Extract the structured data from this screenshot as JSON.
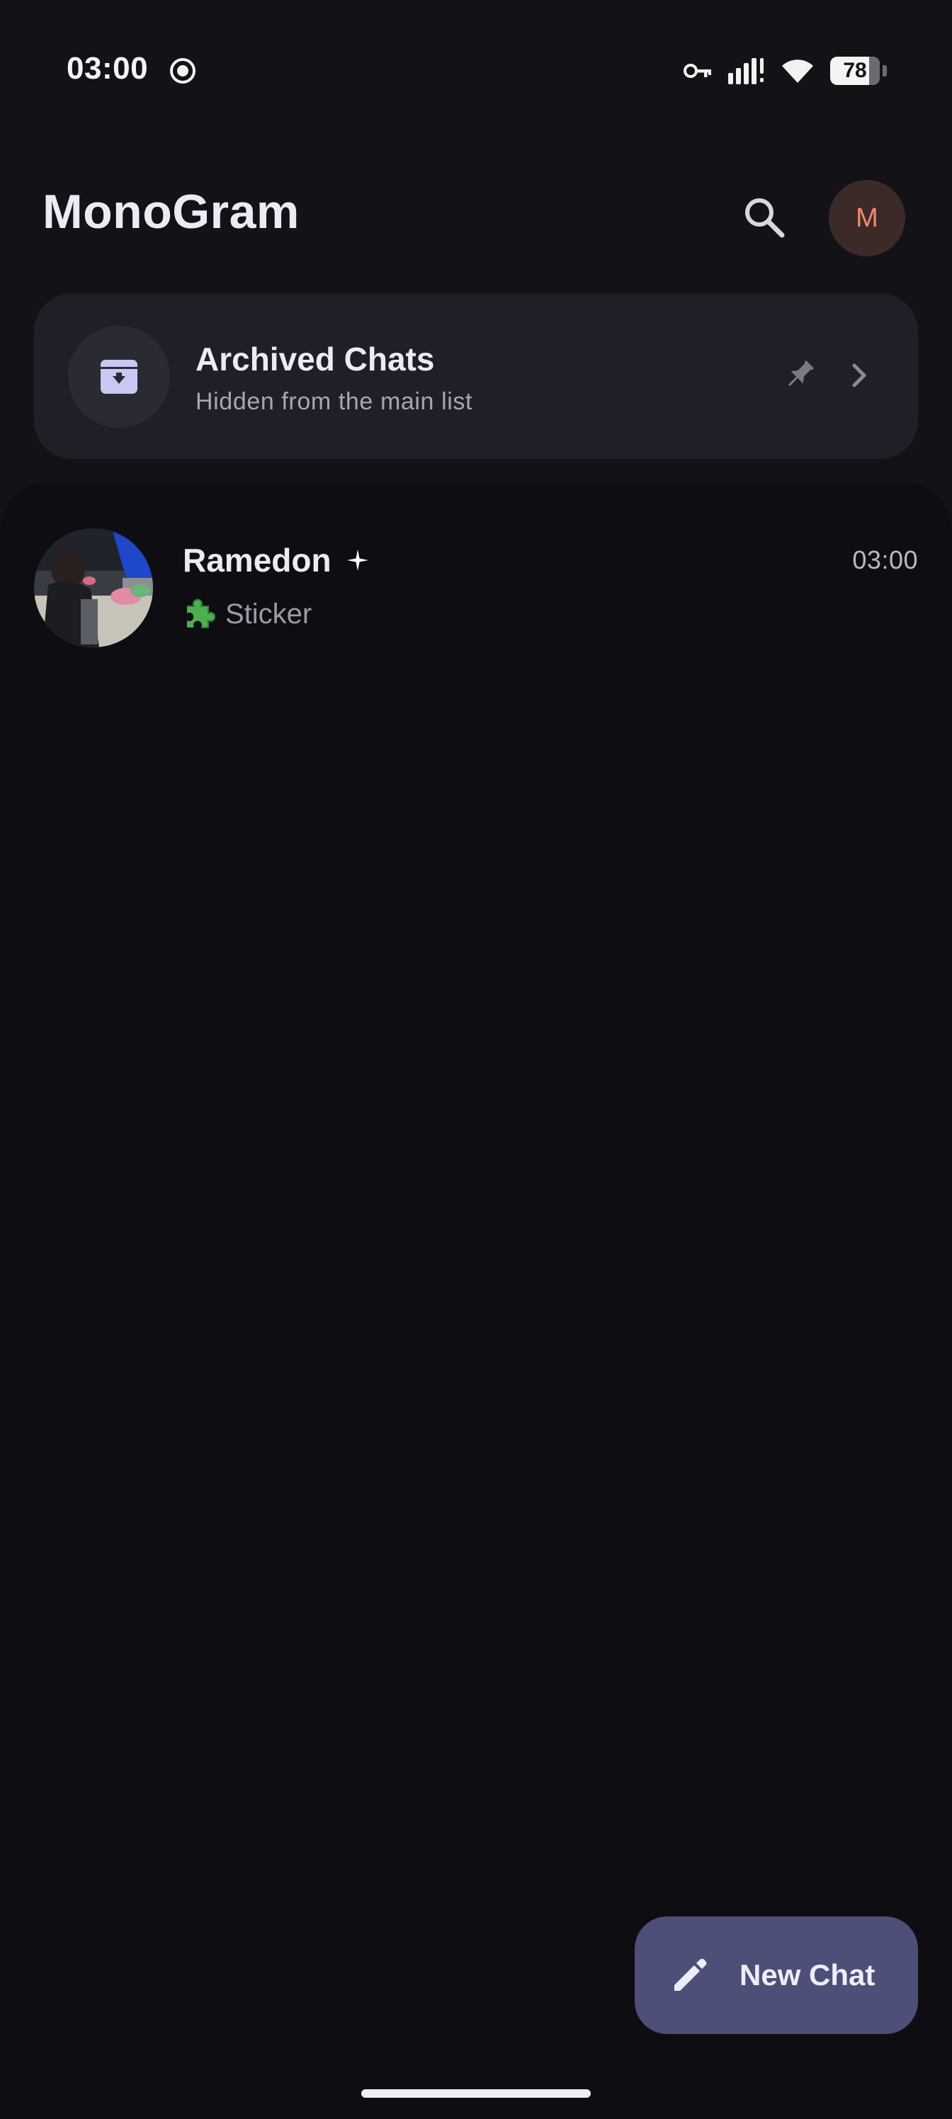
{
  "status_bar": {
    "time": "03:00",
    "battery": "78",
    "battery_level": 0.78,
    "icons": [
      "screen-record-icon",
      "vpn-key-icon",
      "signal-icon",
      "wifi-icon",
      "battery-icon"
    ]
  },
  "header": {
    "title": "MonoGram",
    "search_icon": "search-icon",
    "avatar_initial": "M"
  },
  "archived": {
    "title": "Archived Chats",
    "subtitle": "Hidden from the main list",
    "icon": "archive-icon",
    "pin_icon": "pin-icon",
    "chevron_icon": "chevron-right-icon"
  },
  "chats": [
    {
      "name": "Ramedon",
      "badge_icon": "sparkle-icon",
      "time": "03:00",
      "preview_icon": "puzzle-icon",
      "preview": "Sticker"
    }
  ],
  "fab": {
    "label": "New Chat",
    "icon": "pencil-icon"
  },
  "colors": {
    "background": "#121217",
    "card": "#1f1f27",
    "list_panel": "#0e0e12",
    "fab": "#4d4f78",
    "avatar_initial": "#f08a70",
    "avatar_bg": "#3b2a28"
  }
}
